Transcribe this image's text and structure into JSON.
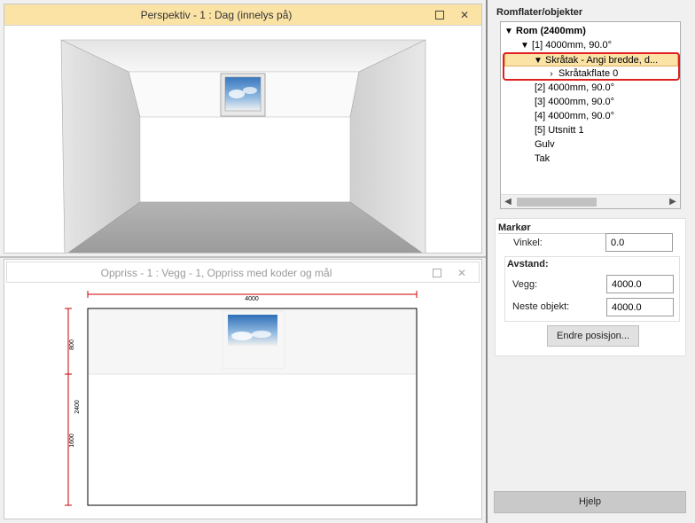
{
  "perspective_window": {
    "title": "Perspektiv - 1 : Dag (innelys på)"
  },
  "elevation_window": {
    "title": "Oppriss - 1 : Vegg - 1, Oppriss med koder og mål",
    "dim_width": "4000",
    "dim_upper": "800",
    "dim_total": "2400",
    "dim_lower": "1600"
  },
  "tree_panel": {
    "header": "Romflater/objekter",
    "items": [
      {
        "label": "Rom (2400mm)",
        "bold": true
      },
      {
        "label": "[1]  4000mm, 90.0°"
      },
      {
        "label": "Skråtak - Angi bredde, d..."
      },
      {
        "label": "Skråtakflate 0"
      },
      {
        "label": "[2]  4000mm, 90.0°"
      },
      {
        "label": "[3]  4000mm, 90.0°"
      },
      {
        "label": "[4]  4000mm, 90.0°"
      },
      {
        "label": "[5] Utsnitt 1"
      },
      {
        "label": "Gulv"
      },
      {
        "label": "Tak"
      }
    ]
  },
  "marker_panel": {
    "header": "Markør",
    "vinkel_label": "Vinkel:",
    "vinkel_value": "0.0",
    "avstand_header": "Avstand:",
    "vegg_label": "Vegg:",
    "vegg_value": "4000.0",
    "neste_label": "Neste objekt:",
    "neste_value": "4000.0",
    "endre_button": "Endre posisjon..."
  },
  "help_button": "Hjelp",
  "colors": {
    "active_title": "#fbe3a6",
    "selection": "#fbe3a6",
    "highlight_border": "#e02020",
    "dimension_line": "#cc0000"
  }
}
